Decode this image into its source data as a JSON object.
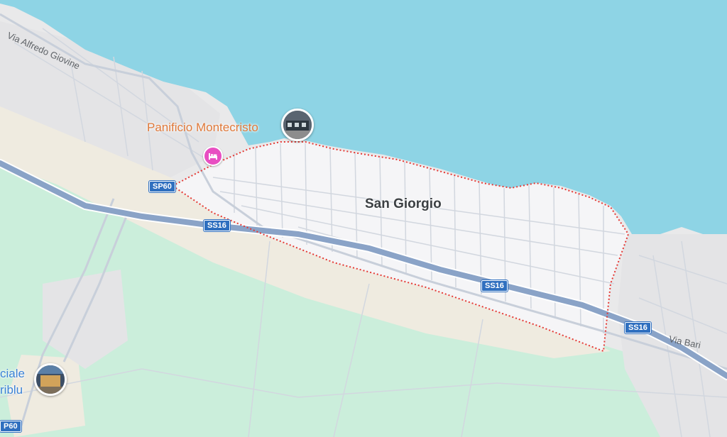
{
  "map": {
    "colors": {
      "sea": "#8ed4e5",
      "land": "#e9e9ea",
      "district": "#f5f5f7",
      "park": "#cbeedb",
      "sand": "#efebe0",
      "highway": "#8aa3c7",
      "boundary": "#e53935",
      "poi_orange": "#e0793a",
      "poi_blue": "#3b82d6",
      "hotel_pin": "#e84fc2"
    },
    "place": {
      "name": "San Giorgio"
    },
    "streets": {
      "via_alfredo_giovine": "Via Alfredo Giovine",
      "via_bari": "Via Bari"
    },
    "road_shields": {
      "sp60_a": "SP60",
      "ss16_a": "SS16",
      "ss16_b": "SS16",
      "ss16_c": "SS16",
      "sp60_b": "P60"
    },
    "pois": {
      "panificio": {
        "name": "Panificio Montecristo",
        "icon": "photo-thumbnail"
      },
      "hotel": {
        "icon": "bed-icon"
      },
      "left_place": {
        "line1": "ciale",
        "line2": "riblu",
        "icon": "photo-thumbnail"
      }
    }
  }
}
